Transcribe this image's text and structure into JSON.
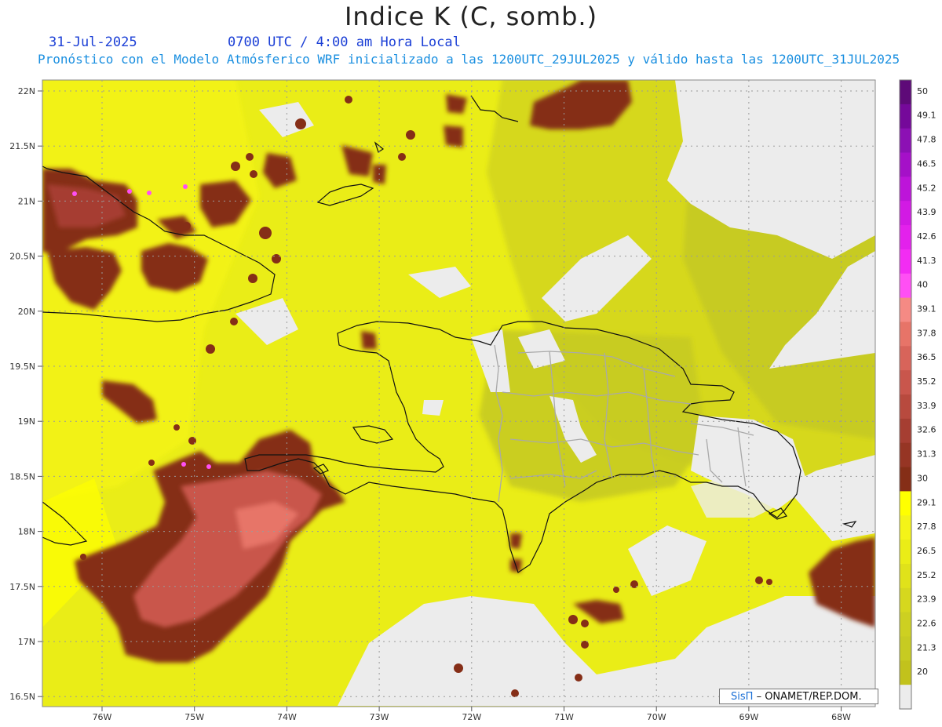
{
  "header": {
    "title": "Indice K (C, somb.)",
    "date": "31-Jul-2025",
    "time": "0700 UTC / 4:00 am Hora Local",
    "description": "Pronóstico con el Modelo Atmósferico WRF inicializado a las 1200UTC_29JUL2025 y válido hasta las  1200UTC_31JUL2025"
  },
  "axes": {
    "lat_labels": [
      "22N",
      "21.5N",
      "21N",
      "20.5N",
      "20N",
      "19.5N",
      "19N",
      "18.5N",
      "18N",
      "17.5N",
      "17N",
      "16.5N"
    ],
    "lon_labels": [
      "76W",
      "75W",
      "74W",
      "73W",
      "72W",
      "71W",
      "70W",
      "69W",
      "68W"
    ],
    "lat_values": [
      22,
      21.5,
      21,
      20.5,
      20,
      19.5,
      19,
      18.5,
      18,
      17.5,
      17,
      16.5
    ],
    "lon_values": [
      -76,
      -75,
      -74,
      -73,
      -72,
      -71,
      -70,
      -69,
      -68
    ]
  },
  "colorbar": {
    "levels": [
      {
        "label": "50",
        "color": "#5e0a78"
      },
      {
        "label": "49.1",
        "color": "#75099a"
      },
      {
        "label": "47.8",
        "color": "#8c10b4"
      },
      {
        "label": "46.5",
        "color": "#a510c8"
      },
      {
        "label": "45.2",
        "color": "#bd14d9"
      },
      {
        "label": "43.9",
        "color": "#d21ae4"
      },
      {
        "label": "42.6",
        "color": "#e321ec"
      },
      {
        "label": "41.3",
        "color": "#f22cf3"
      },
      {
        "label": "40",
        "color": "#ff4ff4"
      },
      {
        "label": "39.1",
        "color": "#f58a84"
      },
      {
        "label": "37.8",
        "color": "#e77468"
      },
      {
        "label": "36.5",
        "color": "#d8645a"
      },
      {
        "label": "35.2",
        "color": "#c9564c"
      },
      {
        "label": "33.9",
        "color": "#b84a3e"
      },
      {
        "label": "32.6",
        "color": "#a63e32"
      },
      {
        "label": "31.3",
        "color": "#963524"
      },
      {
        "label": "30",
        "color": "#852e17"
      },
      {
        "label": "29.1",
        "color": "#ffff00"
      },
      {
        "label": "27.8",
        "color": "#f4f418"
      },
      {
        "label": "26.5",
        "color": "#eaed17"
      },
      {
        "label": "25.2",
        "color": "#e0e21a"
      },
      {
        "label": "23.9",
        "color": "#d6d81e"
      },
      {
        "label": "22.6",
        "color": "#cdd021"
      },
      {
        "label": "21.3",
        "color": "#c7cb22"
      },
      {
        "label": "20",
        "color": "#c2c21c"
      },
      {
        "label": "",
        "color": "#ececec"
      }
    ]
  },
  "credit": {
    "system": "SisΠ",
    "org": "– ONAMET/REP.DOM."
  }
}
